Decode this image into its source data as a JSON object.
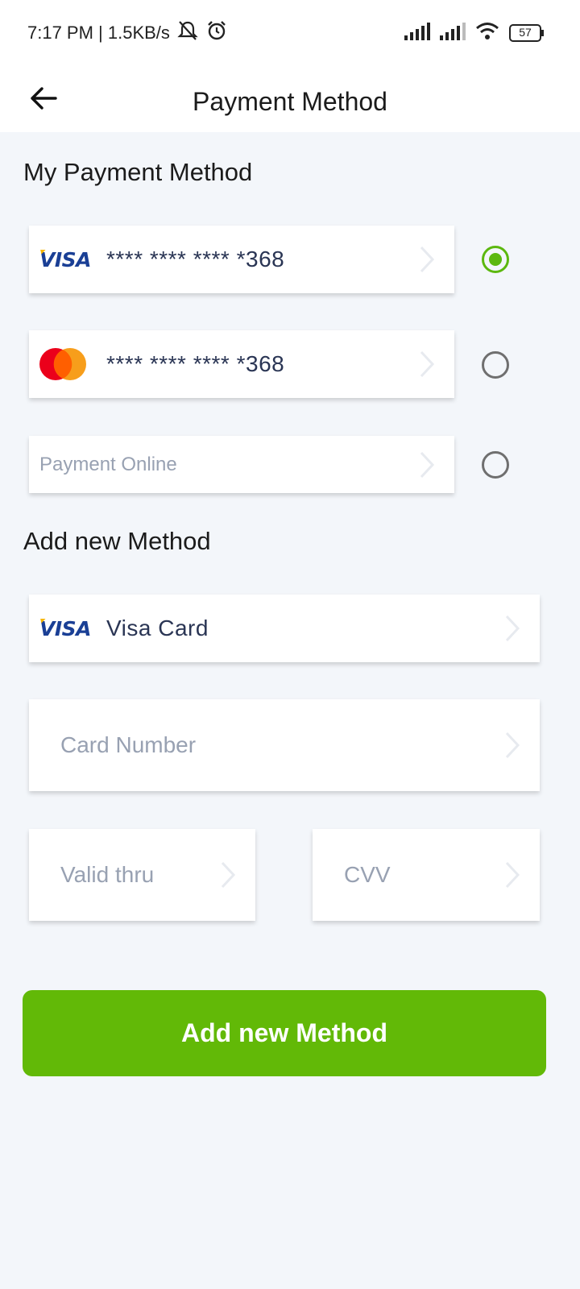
{
  "status_bar": {
    "time_speed": "7:17 PM | 1.5KB/s",
    "battery": "57"
  },
  "header": {
    "title": "Payment Method"
  },
  "my_methods": {
    "title": "My Payment Method",
    "items": [
      {
        "brand": "VISA",
        "number": "**** **** **** *368",
        "selected": true
      },
      {
        "brand": "mastercard",
        "number": "**** **** **** *368",
        "selected": false
      },
      {
        "label": "Payment Online",
        "selected": false
      }
    ]
  },
  "add_method": {
    "title": "Add new Method",
    "card_type": {
      "brand": "VISA",
      "label": "Visa Card"
    },
    "card_number_placeholder": "Card Number",
    "valid_thru_placeholder": "Valid thru",
    "cvv_placeholder": "CVV",
    "button_label": "Add new Method"
  },
  "colors": {
    "accent": "#62b907",
    "background": "#f3f6fa"
  }
}
